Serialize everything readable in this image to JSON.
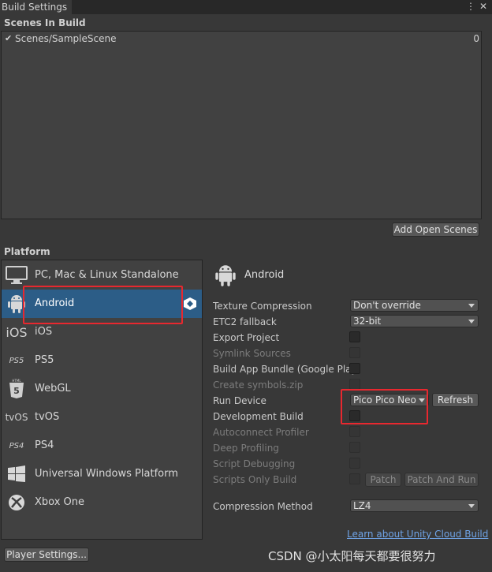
{
  "window": {
    "tab_title": "Build Settings",
    "menu_icon": "more-vertical-icon",
    "close_icon": "close-icon"
  },
  "scenes": {
    "label": "Scenes In Build",
    "items": [
      {
        "checked": true,
        "name": "Scenes/SampleScene",
        "index": "0"
      }
    ],
    "add_open_scenes_label": "Add Open Scenes"
  },
  "platform": {
    "label": "Platform",
    "items": [
      {
        "label": "PC, Mac & Linux Standalone",
        "icon": "monitor-icon"
      },
      {
        "label": "Android",
        "icon": "android-icon",
        "selected": true
      },
      {
        "label": "iOS",
        "icon": "ios-icon"
      },
      {
        "label": "PS5",
        "icon": "ps5-icon"
      },
      {
        "label": "WebGL",
        "icon": "html5-icon"
      },
      {
        "label": "tvOS",
        "icon": "tvos-icon"
      },
      {
        "label": "PS4",
        "icon": "ps4-icon"
      },
      {
        "label": "Universal Windows Platform",
        "icon": "windows-icon"
      },
      {
        "label": "Xbox One",
        "icon": "xbox-icon"
      }
    ],
    "icon_texts": {
      "ios": "iOS",
      "ps5": "PS5",
      "html": "HTML",
      "html5": "5",
      "tvos": "tvOS",
      "ps4": "PS4"
    }
  },
  "settings": {
    "header": "Android",
    "texture_compression": {
      "label": "Texture Compression",
      "value": "Don't override"
    },
    "etc2_fallback": {
      "label": "ETC2 fallback",
      "value": "32-bit"
    },
    "export_project": {
      "label": "Export Project"
    },
    "symlink_sources": {
      "label": "Symlink Sources"
    },
    "build_app_bundle": {
      "label": "Build App Bundle (Google Play"
    },
    "create_symbols": {
      "label": "Create symbols.zip"
    },
    "run_device": {
      "label": "Run Device",
      "value": "Pico Pico Neo",
      "refresh_label": "Refresh"
    },
    "development_build": {
      "label": "Development Build"
    },
    "autoconnect_profiler": {
      "label": "Autoconnect Profiler"
    },
    "deep_profiling": {
      "label": "Deep Profiling"
    },
    "script_debugging": {
      "label": "Script Debugging"
    },
    "scripts_only_build": {
      "label": "Scripts Only Build",
      "patch_label": "Patch",
      "patch_and_run_label": "Patch And Run"
    },
    "compression_method": {
      "label": "Compression Method",
      "value": "LZ4"
    }
  },
  "footer": {
    "cloud_link": "Learn about Unity Cloud Build",
    "player_settings_label": "Player Settings...",
    "watermark": "CSDN @小太阳每天都要很努力"
  },
  "colors": {
    "selected": "#2c5d87",
    "highlight": "#e8282f",
    "link": "#6fa3e6",
    "background": "#383838"
  }
}
